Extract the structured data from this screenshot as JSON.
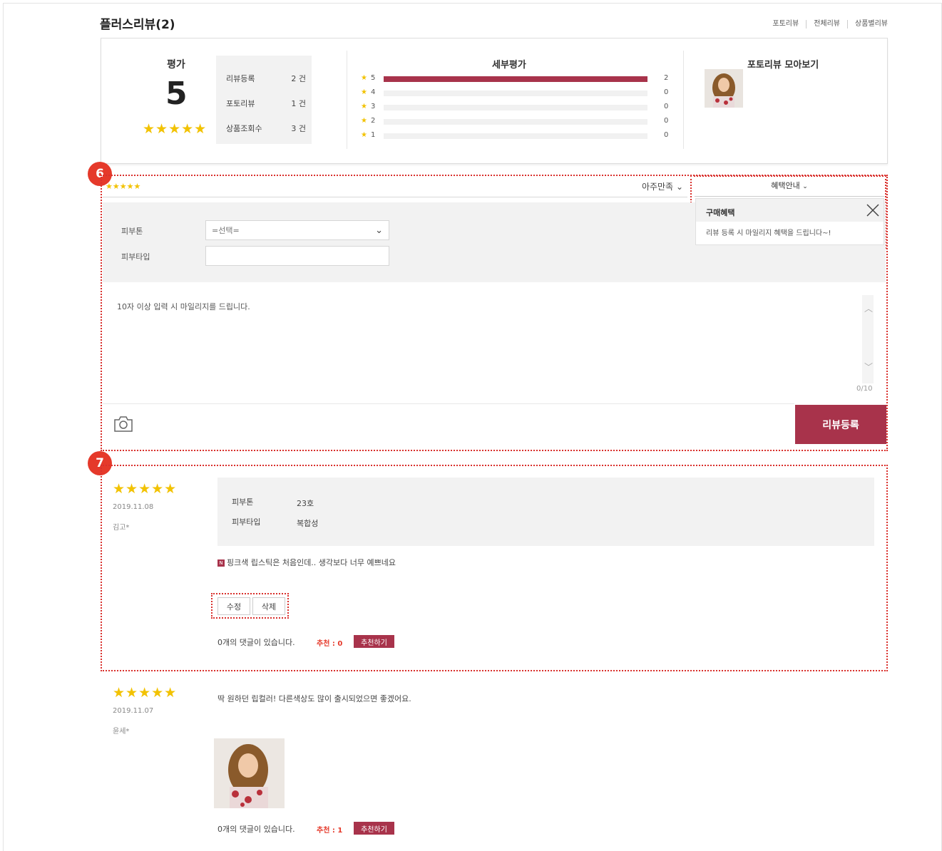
{
  "header": {
    "title": "플러스리뷰(2)",
    "links": [
      "포토리뷰",
      "전체리뷰",
      "상품별리뷰"
    ]
  },
  "summary": {
    "rating_label": "평가",
    "rating_value": "5",
    "rating_stars": "★★★★★",
    "stats": [
      {
        "label": "리뷰등록",
        "value": "2 건"
      },
      {
        "label": "포토리뷰",
        "value": "1 건"
      },
      {
        "label": "상품조회수",
        "value": "3 건"
      }
    ],
    "detail_label": "세부평가",
    "bars": [
      {
        "star": "5",
        "fraction": 1.0,
        "count": "2"
      },
      {
        "star": "4",
        "fraction": 0,
        "count": "0"
      },
      {
        "star": "3",
        "fraction": 0,
        "count": "0"
      },
      {
        "star": "2",
        "fraction": 0,
        "count": "0"
      },
      {
        "star": "1",
        "fraction": 0,
        "count": "0"
      }
    ],
    "photo_label": "포토리뷰 모아보기"
  },
  "callouts": {
    "first": "6",
    "second": "7"
  },
  "form": {
    "stars": "★★★★★",
    "satisfaction": "아주만족",
    "skin_tone_label": "피부톤",
    "skin_tone_value": "=선택=",
    "skin_type_label": "피부타입",
    "skin_type_value": "",
    "textarea_placeholder": "10자 이상 입력 시 마일리지를 드립니다.",
    "counter": "0/10",
    "submit": "리뷰등록"
  },
  "benefit": {
    "head": "혜택안내",
    "title": "구매혜택",
    "body": "리뷰 등록 시 마일리지 혜택을 드립니다~!"
  },
  "reviews": [
    {
      "stars": "★★★★★",
      "date": "2019.11.08",
      "author": "김고*",
      "options": [
        {
          "label": "피부톤",
          "value": "23호"
        },
        {
          "label": "피부타입",
          "value": "복합성"
        }
      ],
      "badge": "N",
      "text": "핑크색 립스틱은 처음인데.. 생각보다 너무 예쁘네요",
      "edit": "수정",
      "delete": "삭제",
      "comments": "0개의 댓글이 있습니다.",
      "recommend": "추천 : 0",
      "recommend_button": "추천하기"
    },
    {
      "stars": "★★★★★",
      "date": "2019.11.07",
      "author": "윤세*",
      "text": "딱 원하던 립컬러! 다른색상도 많이 출시되었으면 좋겠어요.",
      "comments": "0개의 댓글이 있습니다.",
      "recommend": "추천 : 1",
      "recommend_button": "추천하기"
    }
  ],
  "colors": {
    "accent": "#a8334b",
    "star": "#f2c200",
    "callout": "#e5392a"
  }
}
